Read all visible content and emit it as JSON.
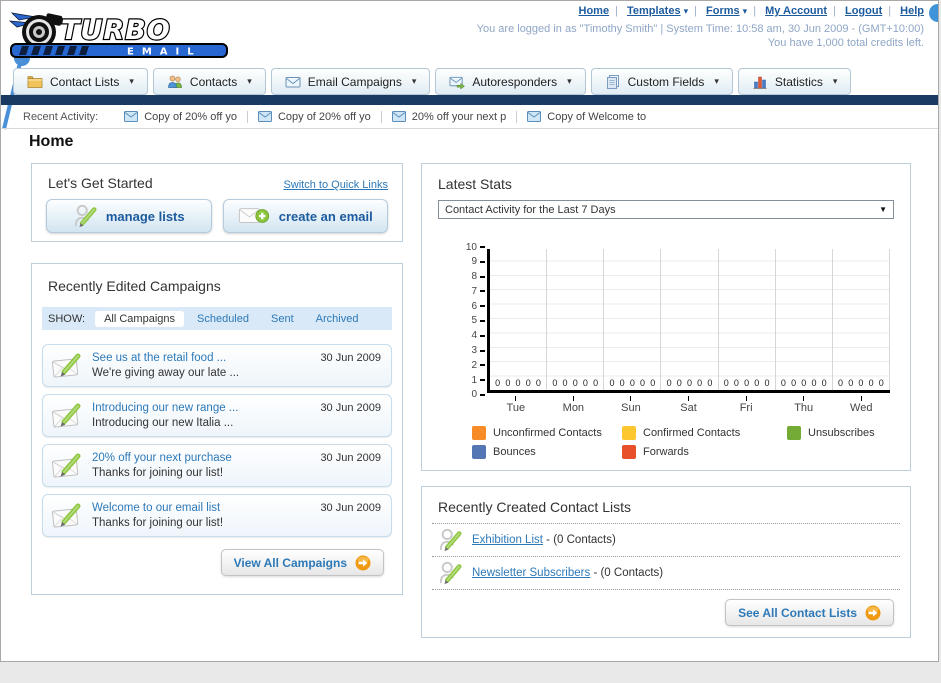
{
  "header": {
    "logo": {
      "title": "TURBO",
      "subtitle": "EMAIL"
    },
    "nav_links": [
      "Home",
      "Templates",
      "Forms",
      "My Account",
      "Logout",
      "Help"
    ],
    "nav_links_dropdown": [
      false,
      true,
      true,
      false,
      false,
      false
    ],
    "login_line1": "You are logged in as \"Timothy Smith\" | System Time: 10:58 am, 30 Jun 2009 - (GMT+10:00)",
    "login_line2": "You have 1,000 total credits left."
  },
  "tabs": [
    {
      "label": "Contact Lists",
      "icon": "folder-icon"
    },
    {
      "label": "Contacts",
      "icon": "people-icon"
    },
    {
      "label": "Email Campaigns",
      "icon": "envelope-icon"
    },
    {
      "label": "Autoresponders",
      "icon": "envelope-arrow-icon"
    },
    {
      "label": "Custom Fields",
      "icon": "pages-icon"
    },
    {
      "label": "Statistics",
      "icon": "chart-icon"
    }
  ],
  "recent_activity": {
    "label": "Recent Activity:",
    "items": [
      "Copy of 20% off yo",
      "Copy of 20% off yo",
      "20% off your next p",
      "Copy of Welcome to"
    ]
  },
  "page_title": "Home",
  "get_started": {
    "title": "Let's Get Started",
    "switch_link": "Switch to Quick Links",
    "buttons": [
      {
        "label": "manage lists"
      },
      {
        "label": "create an email"
      }
    ]
  },
  "campaigns": {
    "title": "Recently Edited Campaigns",
    "show_label": "SHOW:",
    "filters": [
      "All Campaigns",
      "Scheduled",
      "Sent",
      "Archived"
    ],
    "active_filter": "All Campaigns",
    "items": [
      {
        "title": "See us at the retail food ...",
        "subtitle": "We're giving away our late ...",
        "date": "30 Jun 2009"
      },
      {
        "title": "Introducing our new range ...",
        "subtitle": "Introducing our new Italia ...",
        "date": "30 Jun 2009"
      },
      {
        "title": "20% off your next purchase",
        "subtitle": "Thanks for joining our list!",
        "date": "30 Jun 2009"
      },
      {
        "title": "Welcome to our email list",
        "subtitle": "Thanks for joining our list!",
        "date": "30 Jun 2009"
      }
    ],
    "view_all_label": "View All Campaigns"
  },
  "stats": {
    "title": "Latest Stats",
    "dropdown_value": "Contact Activity for the Last 7 Days"
  },
  "chart_data": {
    "type": "bar",
    "title": "Contact Activity for the Last 7 Days",
    "categories": [
      "Tue",
      "Mon",
      "Sun",
      "Sat",
      "Fri",
      "Thu",
      "Wed"
    ],
    "series": [
      {
        "name": "Unconfirmed Contacts",
        "color": "#f68b28",
        "values": [
          0,
          0,
          0,
          0,
          0,
          0,
          0
        ]
      },
      {
        "name": "Confirmed Contacts",
        "color": "#fdc72f",
        "values": [
          0,
          0,
          0,
          0,
          0,
          0,
          0
        ]
      },
      {
        "name": "Unsubscribes",
        "color": "#74aa36",
        "values": [
          0,
          0,
          0,
          0,
          0,
          0,
          0
        ]
      },
      {
        "name": "Bounces",
        "color": "#5576b5",
        "values": [
          0,
          0,
          0,
          0,
          0,
          0,
          0
        ]
      },
      {
        "name": "Forwards",
        "color": "#e8502b",
        "values": [
          0,
          0,
          0,
          0,
          0,
          0,
          0
        ]
      }
    ],
    "ylim": [
      0,
      10
    ],
    "yticks": [
      10,
      9,
      8,
      7,
      6,
      5,
      4,
      3,
      2,
      1,
      0
    ],
    "grid": true,
    "legend_position": "bottom"
  },
  "contact_lists": {
    "title": "Recently Created Contact Lists",
    "items": [
      {
        "name": "Exhibition List",
        "detail": "- (0 Contacts)"
      },
      {
        "name": "Newsletter Subscribers",
        "detail": "- (0 Contacts)"
      }
    ],
    "see_all_label": "See All Contact Lists"
  }
}
